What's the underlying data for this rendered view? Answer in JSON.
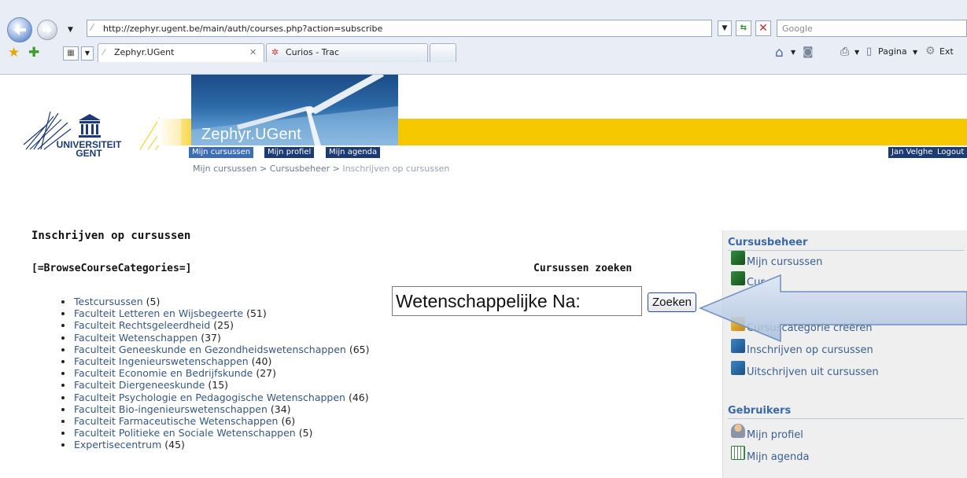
{
  "browser": {
    "url": "http://zephyr.ugent.be/main/auth/courses.php?action=subscribe",
    "search_placeholder": "Google",
    "tabs": [
      {
        "label": "Zephyr.UGent",
        "active": true
      },
      {
        "label": "Curios - Trac",
        "active": false
      }
    ],
    "toolbar": {
      "page_label": "Pagina",
      "extras_label": "Ext"
    }
  },
  "site": {
    "title": "Zephyr.UGent",
    "logo_line1": "UNIVERSITEIT",
    "logo_line2": "GENT",
    "nav": [
      "Mijn cursussen",
      "Mijn profiel",
      "Mijn agenda"
    ],
    "user": "Jan Velghe",
    "logout": "Logout",
    "breadcrumb": {
      "item1": "Mijn cursussen",
      "sep": " > ",
      "item2": "Cursusbeheer",
      "item3": "Inschrijven op cursussen"
    }
  },
  "main": {
    "heading": "Inschrijven op cursussen",
    "browse_label": "[=BrowseCourseCategories=]",
    "search": {
      "heading": "Cursussen zoeken",
      "value": "Wetenschappelijke Na:",
      "button": "Zoeken"
    },
    "faculties": [
      {
        "name": "Testcursussen",
        "count": "(5)"
      },
      {
        "name": "Faculteit Letteren en Wijsbegeerte",
        "count": "(51)"
      },
      {
        "name": "Faculteit Rechtsgeleerdheid",
        "count": "(25)"
      },
      {
        "name": "Faculteit Wetenschappen",
        "count": "(37)"
      },
      {
        "name": "Faculteit Geneeskunde en Gezondheidswetenschappen",
        "count": "(65)"
      },
      {
        "name": "Faculteit Ingenieurswetenschappen",
        "count": "(40)"
      },
      {
        "name": "Faculteit Economie en Bedrijfskunde",
        "count": "(27)"
      },
      {
        "name": "Faculteit Diergeneeskunde",
        "count": "(15)"
      },
      {
        "name": "Faculteit Psychologie en Pedagogische Wetenschappen",
        "count": "(46)"
      },
      {
        "name": "Faculteit Bio-ingenieurswetenschappen",
        "count": "(34)"
      },
      {
        "name": "Faculteit Farmaceutische Wetenschappen",
        "count": "(6)"
      },
      {
        "name": "Faculteit Politieke en Sociale Wetenschappen",
        "count": "(5)"
      },
      {
        "name": "Expertisecentrum",
        "count": "(45)"
      }
    ]
  },
  "sidebar": {
    "course_admin": {
      "title": "Cursusbeheer",
      "items": [
        "Mijn cursussen",
        "Cursuscategorie creëren",
        "Inschrijven op cursussen",
        "Uitschrijven uit cursussen"
      ],
      "partial_item": "Cur"
    },
    "users": {
      "title": "Gebruikers",
      "items": [
        "Mijn profiel",
        "Mijn agenda"
      ]
    }
  },
  "colors": {
    "accent_yellow": "#f6c800",
    "nav_dark": "#1d3b73",
    "link": "#36577f",
    "sidebar_head": "#3a6aa5"
  }
}
